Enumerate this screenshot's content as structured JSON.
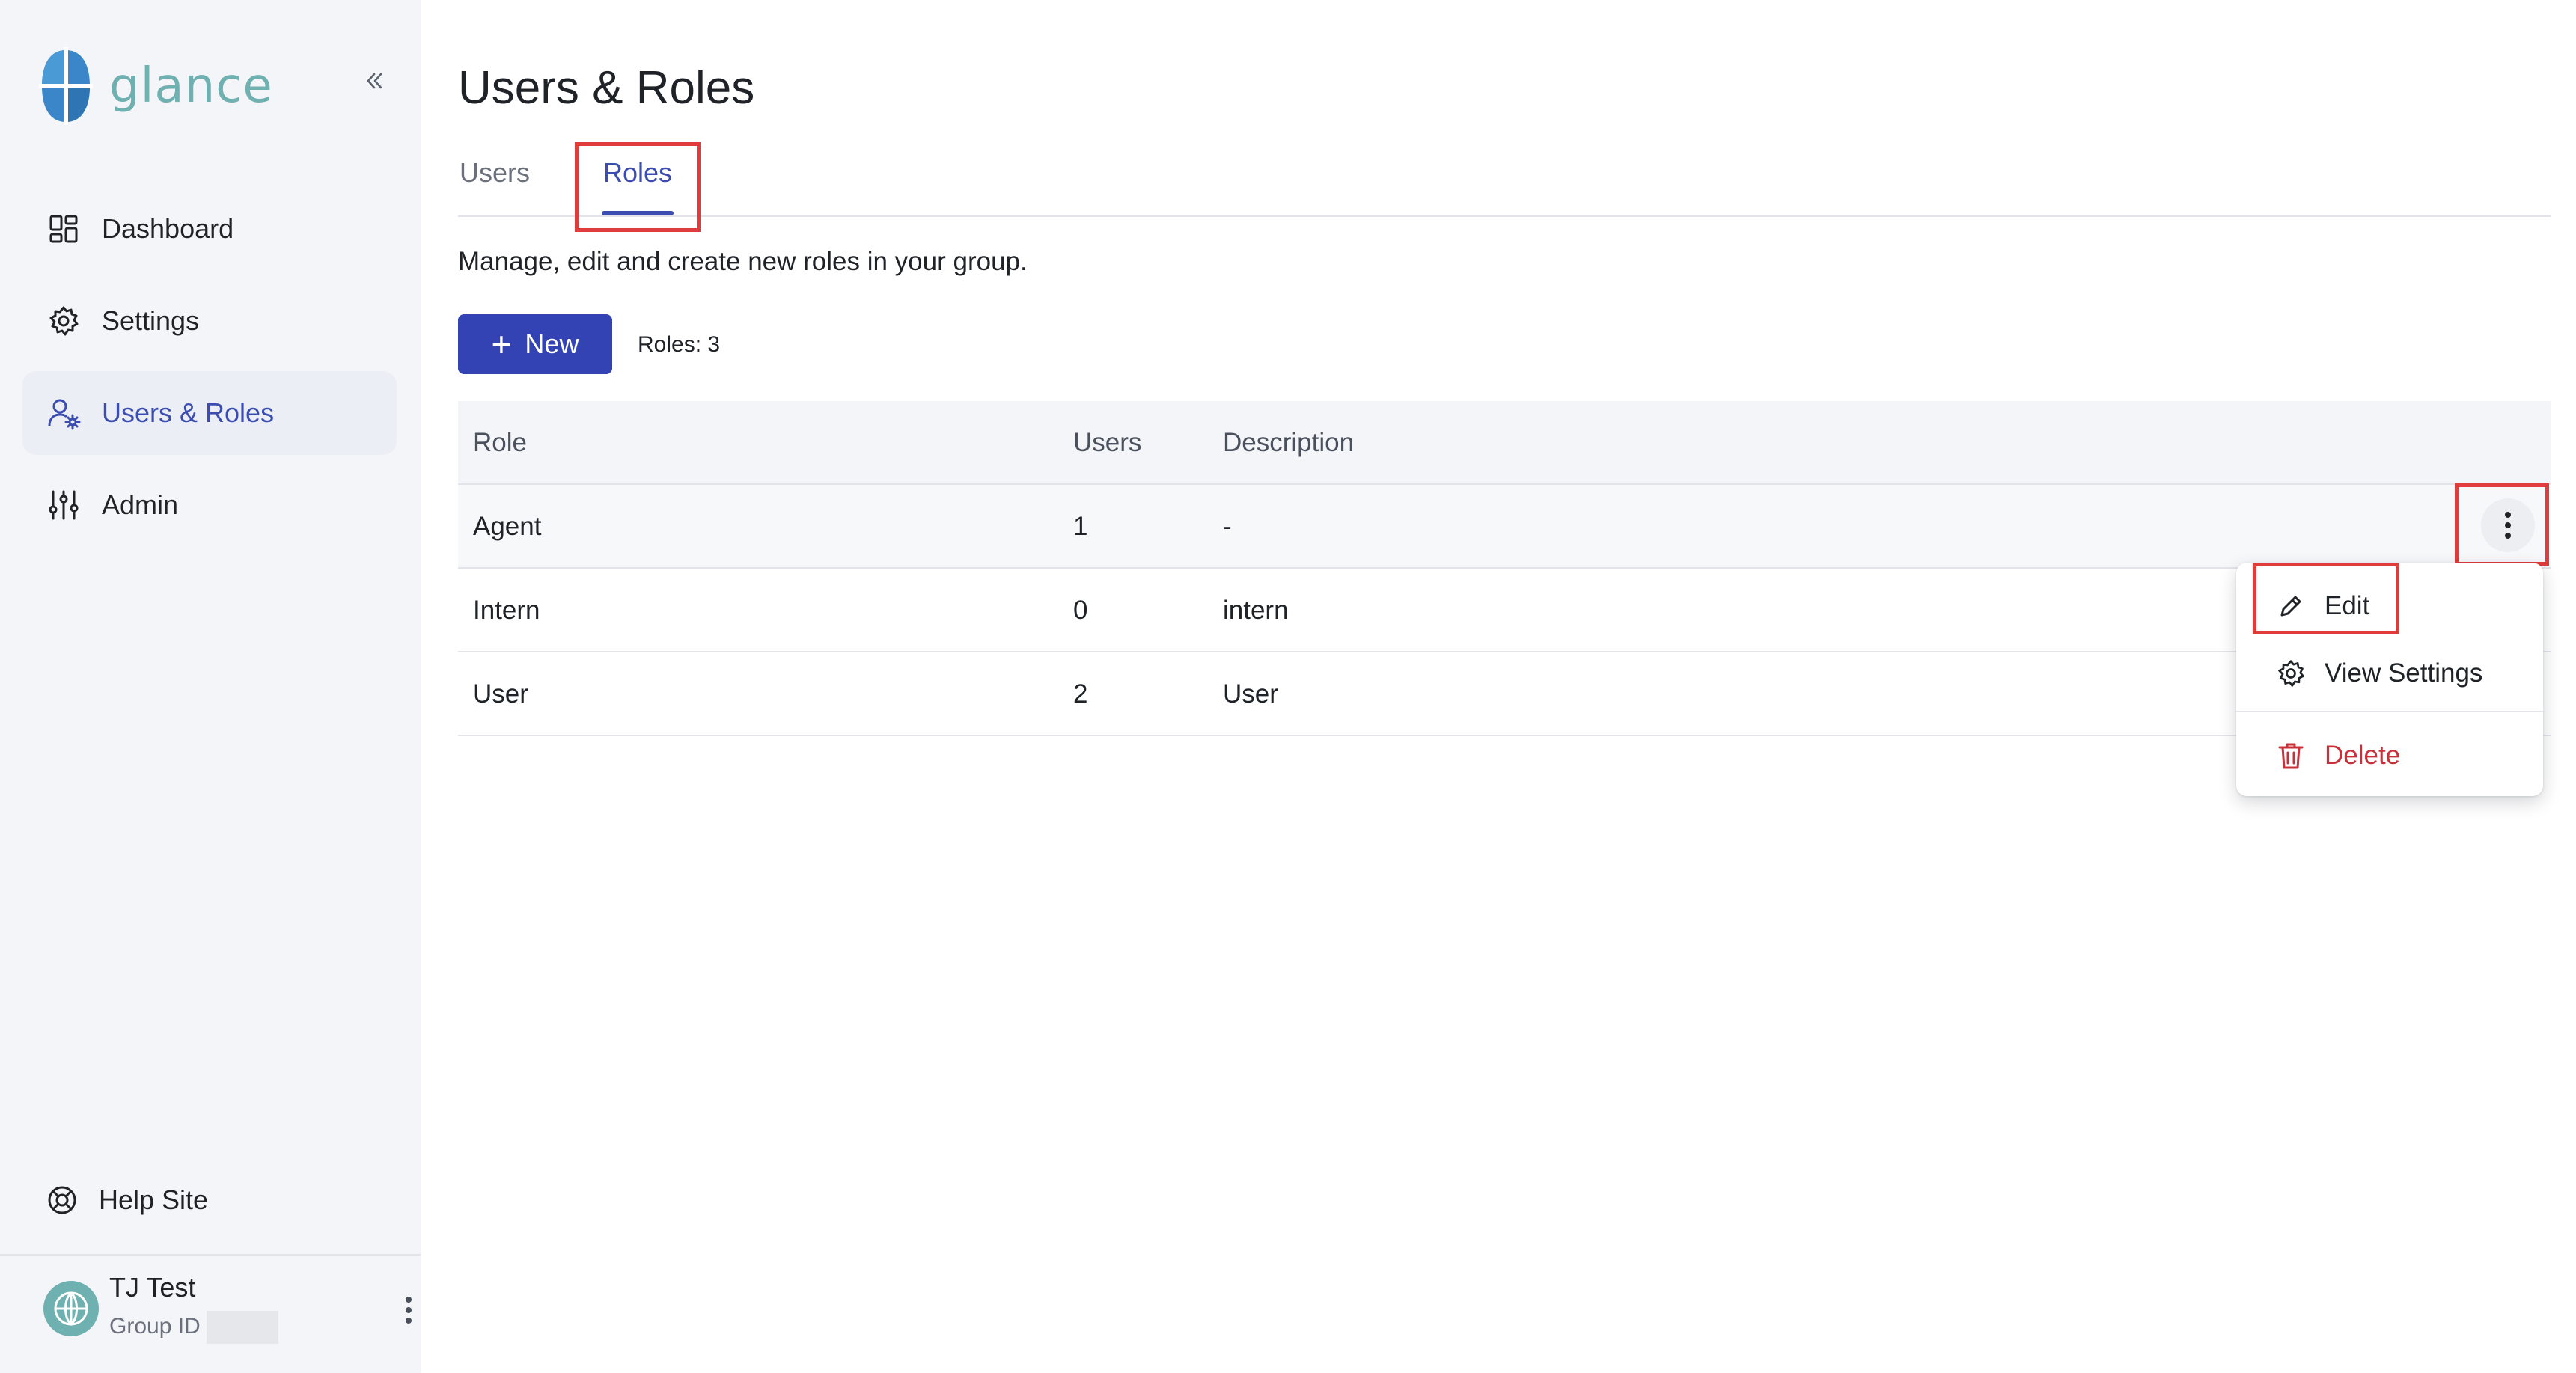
{
  "colors": {
    "accent": "#3b4db0",
    "button": "#3343b4",
    "danger": "#c8313a",
    "highlight": "#e03c3c",
    "logo": "#6fb0b0"
  },
  "sidebar": {
    "logo_text": "glance",
    "collapse_icon": "double-chevron-left-icon",
    "items": [
      {
        "label": "Dashboard",
        "icon": "dashboard-icon",
        "active": false
      },
      {
        "label": "Settings",
        "icon": "gear-icon",
        "active": false
      },
      {
        "label": "Users & Roles",
        "icon": "user-gear-icon",
        "active": true
      },
      {
        "label": "Admin",
        "icon": "sliders-icon",
        "active": false
      }
    ],
    "help": {
      "label": "Help Site",
      "icon": "lifebuoy-icon"
    },
    "user": {
      "name": "TJ Test",
      "group_label": "Group ID",
      "menu_icon": "vertical-dots-icon"
    }
  },
  "main": {
    "title": "Users & Roles",
    "tabs": [
      {
        "label": "Users",
        "active": false
      },
      {
        "label": "Roles",
        "active": true
      }
    ],
    "subtitle": "Manage, edit and create new roles in your group.",
    "new_button": {
      "label": "New",
      "icon": "plus-icon"
    },
    "roles_count": "Roles: 3",
    "table": {
      "columns": [
        "Role",
        "Users",
        "Description"
      ],
      "rows": [
        {
          "role": "Agent",
          "users": "1",
          "description": "-"
        },
        {
          "role": "Intern",
          "users": "0",
          "description": "intern"
        },
        {
          "role": "User",
          "users": "2",
          "description": "User"
        }
      ]
    },
    "row_menu": {
      "items": [
        {
          "label": "Edit",
          "icon": "pencil-icon"
        },
        {
          "label": "View Settings",
          "icon": "gear-icon"
        },
        {
          "label": "Delete",
          "icon": "trash-icon"
        }
      ]
    }
  }
}
